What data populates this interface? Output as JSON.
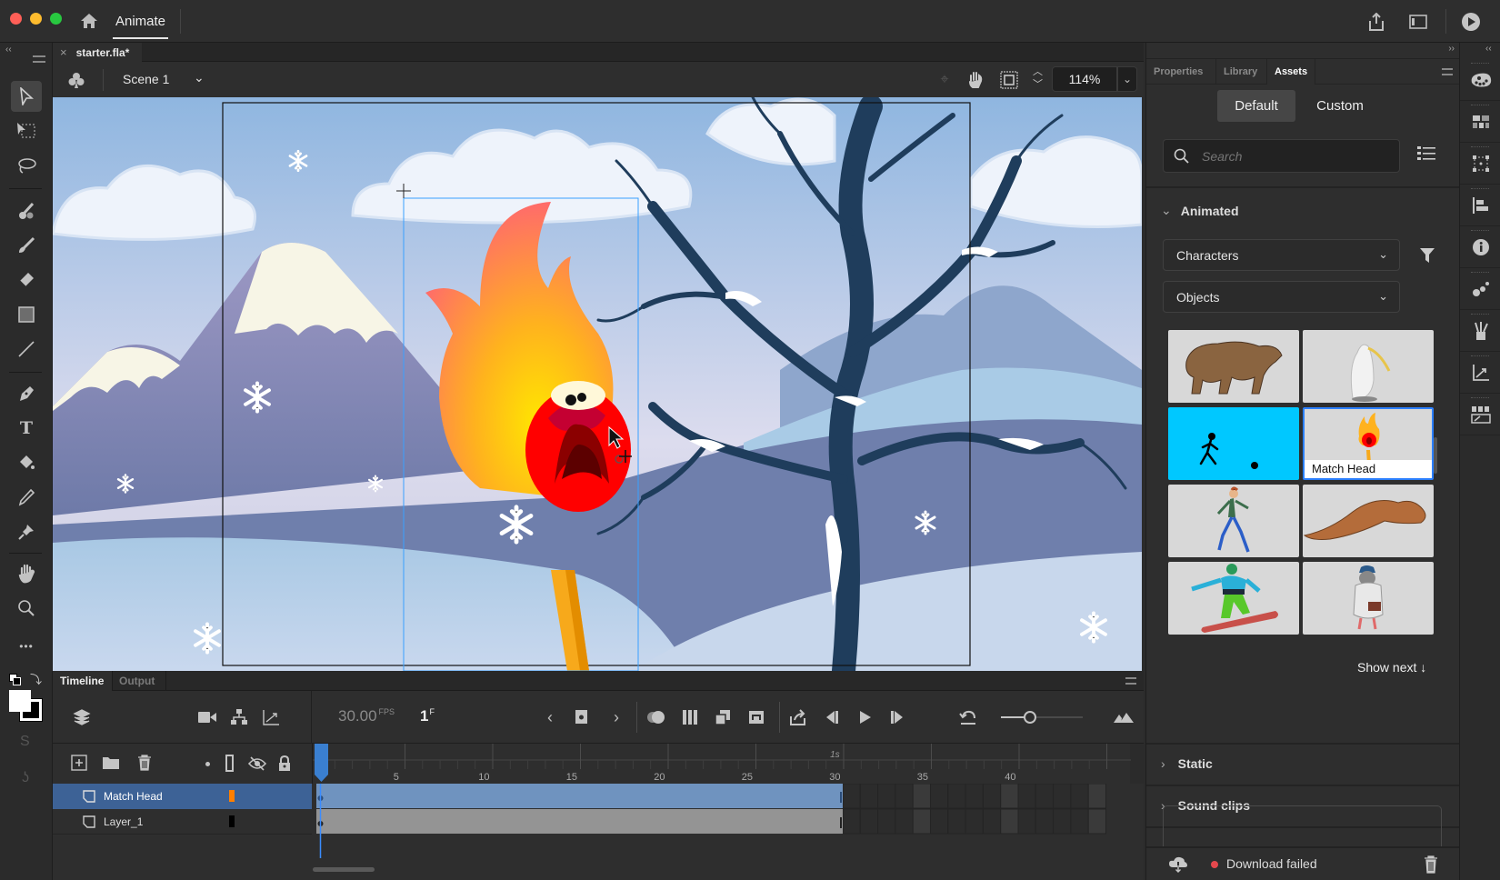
{
  "titlebar": {
    "app_name": "Animate",
    "traffic_lights": {
      "close": "#ff5f57",
      "minimize": "#febc2e",
      "maximize": "#28c840"
    },
    "icons": [
      "home-icon",
      "share-icon",
      "workspace-layout-icon",
      "test-movie-play-icon"
    ]
  },
  "document": {
    "tab_label": "starter.fla*",
    "scene_label": "Scene 1",
    "zoom": "114%"
  },
  "tools": [
    {
      "name": "selection-tool",
      "glyph": "➤"
    },
    {
      "name": "free-transform-tool",
      "glyph": "⬚"
    },
    {
      "name": "lasso-tool",
      "glyph": "◌"
    },
    {
      "name": "paint-brush-tool",
      "glyph": "🖌"
    },
    {
      "name": "brush-tool",
      "glyph": "╱"
    },
    {
      "name": "eraser-tool",
      "glyph": "◆"
    },
    {
      "name": "rectangle-tool",
      "glyph": "■"
    },
    {
      "name": "line-tool",
      "glyph": "／"
    },
    {
      "name": "pen-tool",
      "glyph": "✒"
    },
    {
      "name": "text-tool",
      "glyph": "T"
    },
    {
      "name": "paint-bucket-tool",
      "glyph": "⛽"
    },
    {
      "name": "eyedropper-tool",
      "glyph": "⚲"
    },
    {
      "name": "asset-warp-tool",
      "glyph": "📌"
    },
    {
      "name": "hand-tool",
      "glyph": "✋"
    },
    {
      "name": "zoom-tool",
      "glyph": "⚲"
    },
    {
      "name": "more-tools",
      "glyph": "•••"
    }
  ],
  "timeline": {
    "tabs": [
      "Timeline",
      "Output"
    ],
    "active_tab": "Timeline",
    "fps": "30.00",
    "fps_unit": "FPS",
    "current_frame": "1",
    "frame_unit": "F",
    "ruler_labels": [
      "5",
      "10",
      "15",
      "20",
      "25",
      "30",
      "35",
      "40"
    ],
    "ruler_seconds_label": "1s",
    "layers": [
      {
        "name": "Match Head",
        "color": "#ff7f00",
        "selected": true,
        "span_frames": 30
      },
      {
        "name": "Layer_1",
        "color": "#000000",
        "selected": false,
        "span_frames": 30
      }
    ],
    "frame_zoom_level": 0.35
  },
  "panel": {
    "tabs": [
      "Properties",
      "Library",
      "Assets"
    ],
    "active_tab": "Assets",
    "toggle": [
      "Default",
      "Custom"
    ],
    "active_toggle": "Default",
    "search_placeholder": "Search",
    "section_animated": "Animated",
    "filter_1": "Characters",
    "filter_2": "Objects",
    "assets": [
      {
        "name": "Bear",
        "label": ""
      },
      {
        "name": "Bird",
        "label": ""
      },
      {
        "name": "Stick Figure",
        "label": ""
      },
      {
        "name": "Match Head",
        "label": "Match Head"
      },
      {
        "name": "Walking Man",
        "label": ""
      },
      {
        "name": "Squirrel",
        "label": ""
      },
      {
        "name": "Snowboarder",
        "label": ""
      },
      {
        "name": "Pigeon",
        "label": ""
      }
    ],
    "show_next": "Show next ↓",
    "section_static": "Static",
    "section_sound": "Sound clips",
    "status": "Download failed",
    "status_color": "#e5484d"
  }
}
